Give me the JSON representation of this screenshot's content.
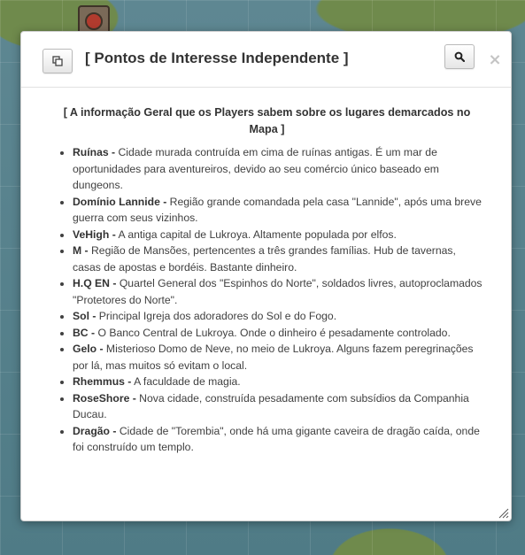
{
  "dialog": {
    "title": "[ Pontos de Interesse Independente ]",
    "close_glyph": "×",
    "icons": {
      "popout": "popout-icon",
      "search": "search-icon",
      "close": "close-icon",
      "resize": "resize-grip-icon"
    }
  },
  "content": {
    "heading": "[ A informação Geral que os Players sabem sobre os lugares demarcados no Mapa ]",
    "places": [
      {
        "name": "Ruínas -",
        "description": " Cidade murada contruída em cima de ruínas antigas. É um mar de oportunidades para aventureiros, devido ao seu comércio único baseado em dungeons."
      },
      {
        "name": "Domínio Lannide -",
        "description": " Região grande comandada pela casa \"Lannide\", após uma breve guerra com seus vizinhos."
      },
      {
        "name": "VeHigh -",
        "description": " A antiga capital de Lukroya. Altamente populada por elfos."
      },
      {
        "name": "M -",
        "description": " Região de Mansões, pertencentes a três grandes famílias. Hub de tavernas, casas de apostas e bordéis. Bastante dinheiro."
      },
      {
        "name": "H.Q EN -",
        "description": " Quartel General dos \"Espinhos do Norte\", soldados livres, autoproclamados \"Protetores do Norte\"."
      },
      {
        "name": "Sol -",
        "description": " Principal Igreja dos adoradores do Sol e do Fogo."
      },
      {
        "name": "BC -",
        "description": " O Banco Central de Lukroya. Onde o dinheiro é pesadamente controlado."
      },
      {
        "name": "Gelo -",
        "description": " Misterioso Domo de Neve, no meio de Lukroya. Alguns fazem peregrinações por lá, mas muitos só evitam o local."
      },
      {
        "name": "Rhemmus -",
        "description": " A faculdade de magia."
      },
      {
        "name": "RoseShore -",
        "description": " Nova cidade, construída pesadamente com subsídios da Companhia Ducau."
      },
      {
        "name": "Dragão -",
        "description": " Cidade de \"Torembia\", onde há uma gigante caveira de dragão caída, onde foi construído um templo."
      }
    ]
  }
}
